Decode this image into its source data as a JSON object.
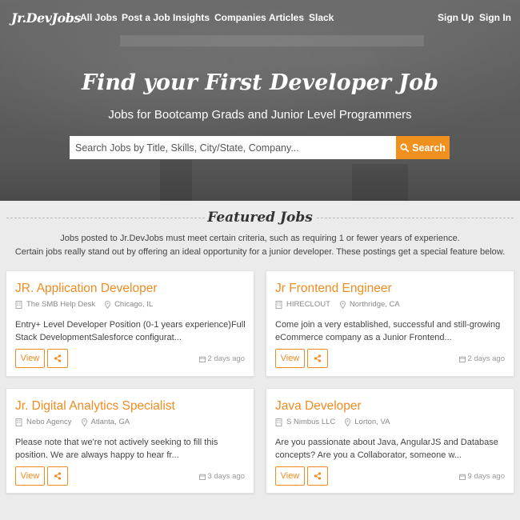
{
  "nav": {
    "logo": "Jr.DevJobs",
    "links": [
      "All Jobs",
      "Post a Job",
      "Insights",
      "Companies",
      "Articles",
      "Slack"
    ],
    "signup": "Sign Up",
    "signin": "Sign In"
  },
  "hero": {
    "title": "Find your First Developer Job",
    "subtitle": "Jobs for Bootcamp Grads and Junior Level Programmers",
    "search_placeholder": "Search Jobs by Title, Skills, City/State, Company...",
    "search_button": "Search"
  },
  "featured": {
    "title": "Featured Jobs",
    "desc1": "Jobs posted to Jr.DevJobs must meet certain criteria, such as requiring 1 or fewer years of experience.",
    "desc2": "Certain jobs really stand out by offering an ideal opportunity for a junior developer. These postings get a special feature below."
  },
  "jobs": [
    {
      "title": "JR. Application Developer",
      "company": "The SMB Help Desk",
      "location": "Chicago, IL",
      "description": "Entry+ Level Developer Position (0-1 years experience)Full Stack DevelopmentSalesforce configurat...",
      "view_label": "View",
      "date": "2 days ago"
    },
    {
      "title": "Jr Frontend Engineer",
      "company": "HIRECLOUT",
      "location": "Northridge, CA",
      "description": "Come join a very established, successful and still-growing eCommerce company as a Junior Frontend...",
      "view_label": "View",
      "date": "2 days ago"
    },
    {
      "title": "Jr. Digital Analytics Specialist",
      "company": "Nebo Agency",
      "location": "Atlanta, GA",
      "description": "Please note that we're not actively seeking to fill this position. We are always happy to hear fr...",
      "view_label": "View",
      "date": "3 days ago"
    },
    {
      "title": "Java Developer",
      "company": "S Nimbus LLC",
      "location": "Lorton, VA",
      "description": "Are you passionate about Java, AngularJS and Database concepts? Are you a Collaborator, someone w...",
      "view_label": "View",
      "date": "9 days ago"
    }
  ],
  "colors": {
    "accent": "#ef8c22",
    "hero_bg": "#5d5d5d",
    "page_bg": "#ebebeb"
  },
  "icons": {
    "company": "building-icon",
    "location": "map-marker-icon",
    "share": "share-icon",
    "date": "calendar-icon",
    "search": "search-icon"
  }
}
